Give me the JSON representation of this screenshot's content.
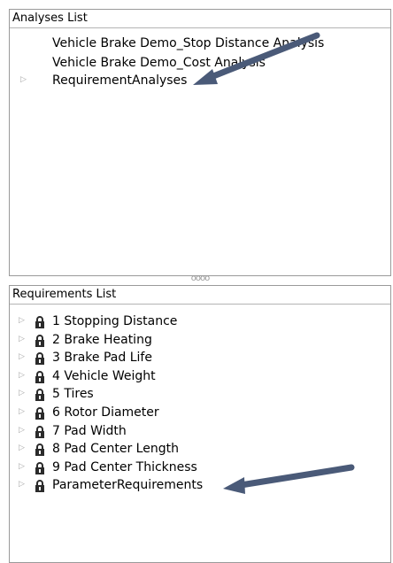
{
  "analyses_list": {
    "title": "Analyses List",
    "items": [
      {
        "label": "Vehicle Brake Demo_Stop Distance Analysis",
        "expandable": false
      },
      {
        "label": "Vehicle Brake Demo_Cost Analysis",
        "expandable": false
      },
      {
        "label": "RequirementAnalyses",
        "expandable": true
      }
    ]
  },
  "splitter": {
    "grip": "oooo"
  },
  "requirements_list": {
    "title": "Requirements List",
    "items": [
      {
        "label": "1 Stopping Distance",
        "icon": "lock-icon"
      },
      {
        "label": "2 Brake Heating",
        "icon": "lock-icon"
      },
      {
        "label": "3 Brake Pad Life",
        "icon": "lock-icon"
      },
      {
        "label": "4 Vehicle Weight",
        "icon": "lock-icon"
      },
      {
        "label": "5 Tires",
        "icon": "lock-icon"
      },
      {
        "label": "6 Rotor Diameter",
        "icon": "lock-icon"
      },
      {
        "label": "7 Pad Width",
        "icon": "lock-icon"
      },
      {
        "label": "8 Pad Center Length",
        "icon": "lock-icon"
      },
      {
        "label": "9 Pad Center Thickness",
        "icon": "lock-icon"
      },
      {
        "label": "ParameterRequirements",
        "icon": "lock-icon"
      }
    ]
  },
  "colors": {
    "annotation_arrow": "#4a5a78",
    "border": "#9a9a9a",
    "expander": "#a8a8a8"
  }
}
